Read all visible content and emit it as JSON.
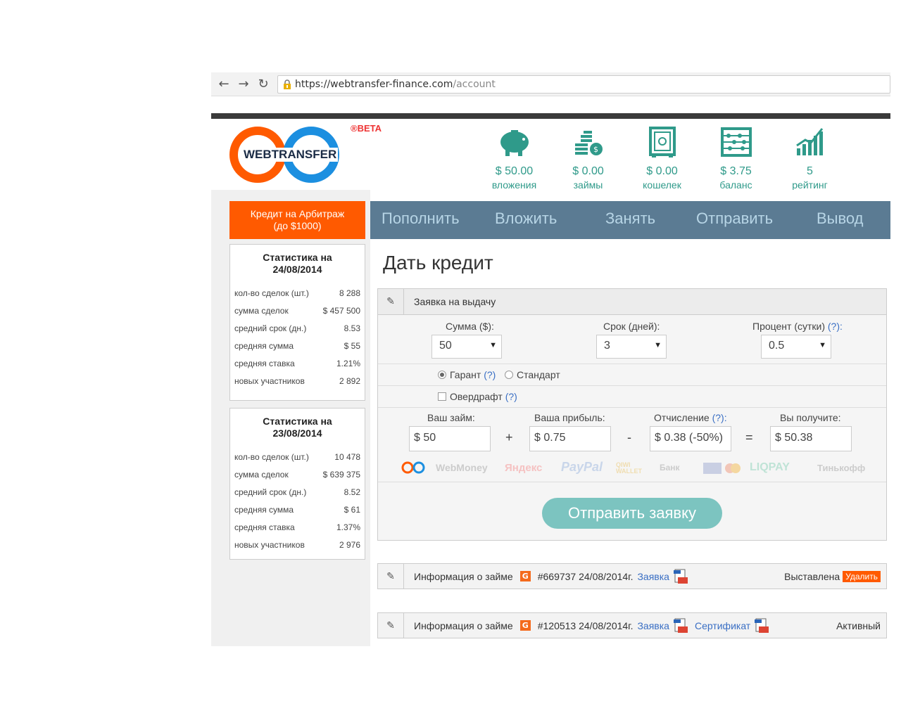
{
  "browser": {
    "url_host": "https://webtransfer-finance.com",
    "url_path": "/account"
  },
  "logo": {
    "text": "WEBTRANSFER",
    "beta": "®BETA"
  },
  "header_stats": [
    {
      "icon": "piggy-bank-icon",
      "value": "$ 50.00",
      "label": "вложения"
    },
    {
      "icon": "coins-icon",
      "value": "$ 0.00",
      "label": "займы"
    },
    {
      "icon": "safe-icon",
      "value": "$ 0.00",
      "label": "кошелек"
    },
    {
      "icon": "abacus-icon",
      "value": "$ 3.75",
      "label": "баланс"
    },
    {
      "icon": "growth-chart-icon",
      "value": "5",
      "label": "рейтинг"
    }
  ],
  "promo": {
    "line1": "Кредит на Арбитраж",
    "line2": "(до $1000)"
  },
  "stats_boxes": [
    {
      "title1": "Статистика на",
      "title2": "24/08/2014",
      "rows": [
        {
          "label": "кол-во сделок (шт.)",
          "value": "8 288"
        },
        {
          "label": "сумма сделок",
          "value": "$ 457 500"
        },
        {
          "label": "средний срок (дн.)",
          "value": "8.53"
        },
        {
          "label": "средняя сумма",
          "value": "$ 55"
        },
        {
          "label": "средняя ставка",
          "value": "1.21%"
        },
        {
          "label": "новых участников",
          "value": "2 892"
        }
      ]
    },
    {
      "title1": "Статистика на",
      "title2": "23/08/2014",
      "rows": [
        {
          "label": "кол-во сделок (шт.)",
          "value": "10 478"
        },
        {
          "label": "сумма сделок",
          "value": "$ 639 375"
        },
        {
          "label": "средний срок (дн.)",
          "value": "8.52"
        },
        {
          "label": "средняя сумма",
          "value": "$ 61"
        },
        {
          "label": "средняя ставка",
          "value": "1.37%"
        },
        {
          "label": "новых участников",
          "value": "2 976"
        }
      ]
    }
  ],
  "menu": [
    "Пополнить",
    "Вложить",
    "Занять",
    "Отправить",
    "Вывод"
  ],
  "page_title": "Дать кредит",
  "form": {
    "header": "Заявка на выдачу",
    "amount_label": "Сумма ($):",
    "amount_value": "50",
    "term_label": "Срок (дней):",
    "term_value": "3",
    "percent_label": "Процент (сутки)",
    "percent_value": "0.5",
    "help": "(?)",
    "help_colon": "(?):",
    "guarant": "Гарант",
    "standard": "Стандарт",
    "overdraft": "Овердрафт",
    "loan_label": "Ваш займ:",
    "loan_value": "$ 50",
    "profit_label": "Ваша прибыль:",
    "profit_value": "$ 0.75",
    "deduction_label": "Отчисление",
    "deduction_value": "$ 0.38 (-50%)",
    "receive_label": "Вы получите:",
    "receive_value": "$ 50.38",
    "op_plus": "+",
    "op_minus": "-",
    "op_eq": "=",
    "payments": [
      "WebMoney",
      "Яндекс",
      "PayPal",
      "QIWI WALLET",
      "Банк",
      "LIQPAY",
      "Тинькофф"
    ],
    "submit": "Отправить заявку"
  },
  "loans": [
    {
      "label": "Информация о займе",
      "badge": "G",
      "number": "#669737 24/08/2014г.",
      "link1": "Заявка",
      "link2": "",
      "status": "Выставлена",
      "delete": "Удалить"
    },
    {
      "label": "Информация о займе",
      "badge": "G",
      "number": "#120513 24/08/2014г.",
      "link1": "Заявка",
      "link2": "Сертификат",
      "status": "Активный",
      "delete": ""
    }
  ],
  "colors": {
    "accent_orange": "#ff5a00",
    "teal": "#2f9a8a",
    "menu_bg": "#5b7b93",
    "logo_blue": "#1c8fe0"
  }
}
